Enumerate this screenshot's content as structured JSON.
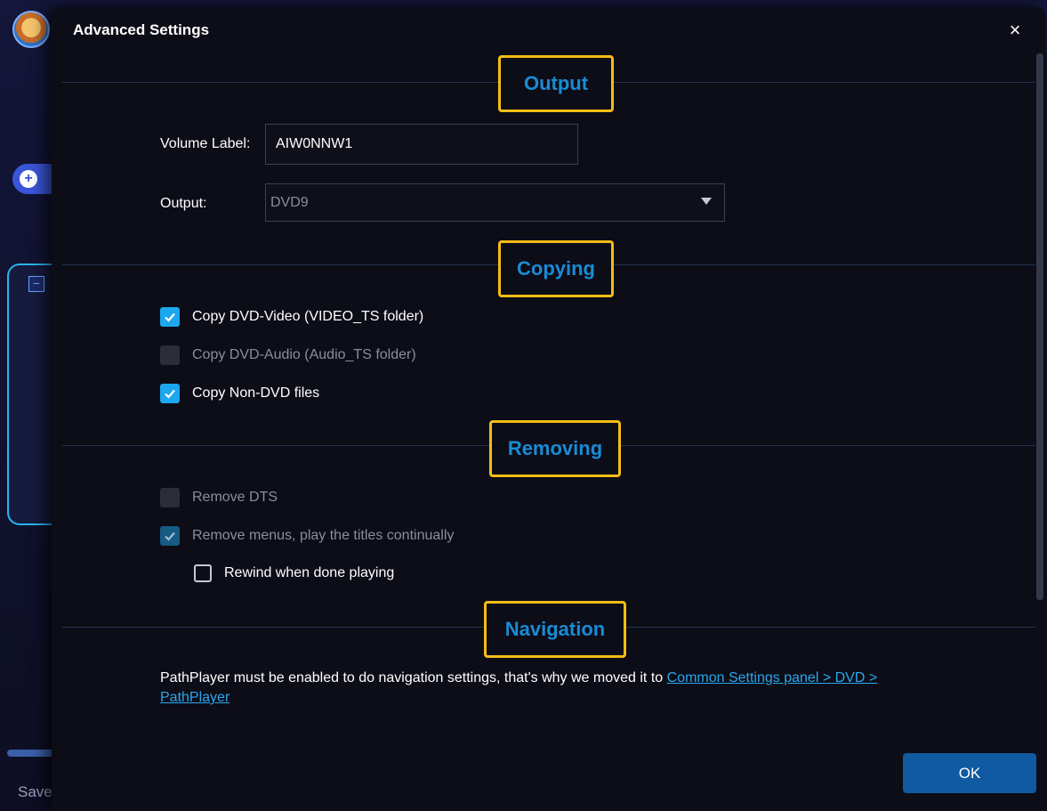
{
  "modal": {
    "title": "Advanced Settings",
    "close_glyph": "×",
    "ok_label": "OK"
  },
  "background": {
    "save_label": "Save"
  },
  "sections": {
    "output": "Output",
    "copying": "Copying",
    "removing": "Removing",
    "navigation": "Navigation"
  },
  "output": {
    "volume_label": "Volume Label:",
    "volume_value": "AIW0NNW1",
    "output_label": "Output:",
    "output_value": "DVD9"
  },
  "copying": {
    "items": [
      {
        "label": "Copy DVD-Video (VIDEO_TS folder)",
        "state": "checked"
      },
      {
        "label": "Copy DVD-Audio (Audio_TS folder)",
        "state": "disabled"
      },
      {
        "label": "Copy Non-DVD files",
        "state": "checked"
      }
    ]
  },
  "removing": {
    "items": [
      {
        "label": "Remove DTS",
        "state": "disabled"
      },
      {
        "label": "Remove menus, play the titles continually",
        "state": "checked-disabled"
      },
      {
        "label": "Rewind when done playing",
        "state": "unchecked"
      }
    ]
  },
  "navigation": {
    "text": "PathPlayer must be enabled to do navigation settings, that's why we moved it to ",
    "link": "Common Settings panel > DVD > PathPlayer"
  },
  "colors": {
    "accent": "#1ca7ee",
    "section_title": "#1a8bd6",
    "highlight_box": "#f5bc16",
    "ok_button": "#0f5aa0"
  }
}
